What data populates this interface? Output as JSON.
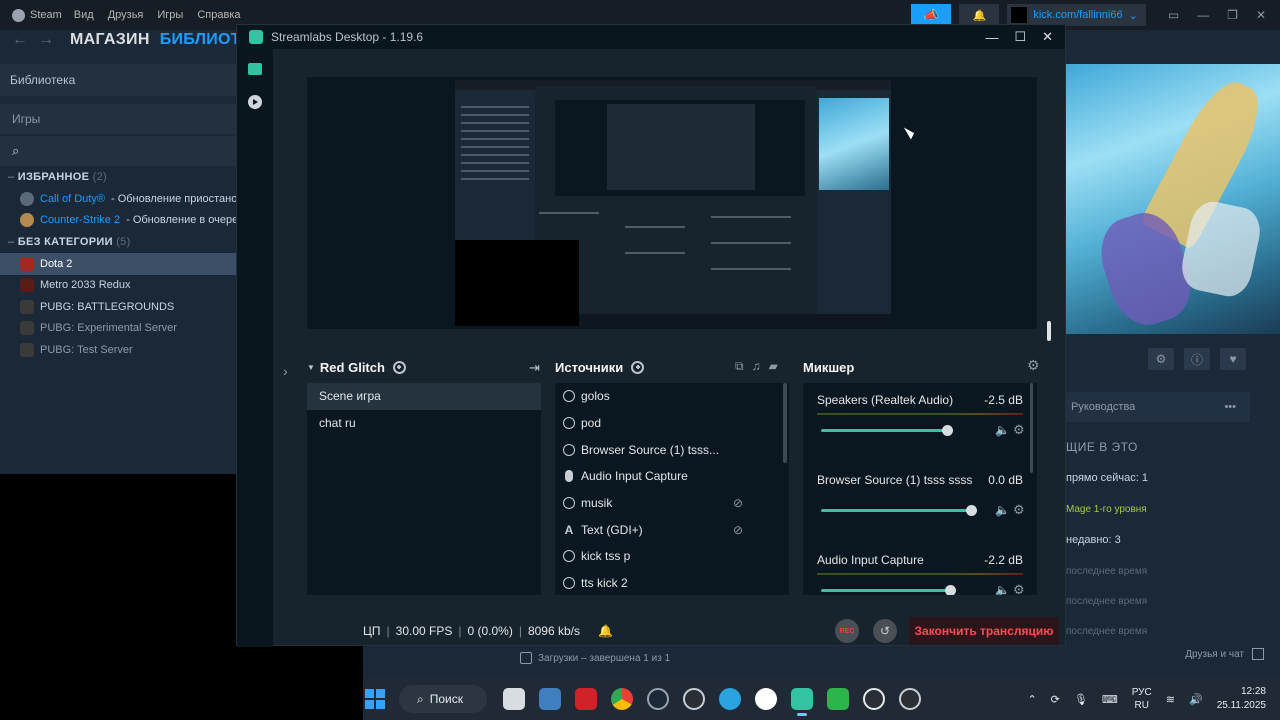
{
  "steam": {
    "app_name": "Steam",
    "menu": [
      "Вид",
      "Друзья",
      "Игры",
      "Справка"
    ],
    "account": "kick.com/fallinni66",
    "nav_store": "МАГАЗИН",
    "nav_library": "БИБЛИОТЕ",
    "library_label": "Библиотека",
    "games_filter": "Игры",
    "favorites": {
      "label": "ИЗБРАННОЕ",
      "count": "(2)"
    },
    "favorite_games": [
      {
        "name": "Call of Duty®",
        "status": " - Обновление приостано"
      },
      {
        "name": "Counter-Strike 2",
        "status": " - Обновление в очере"
      }
    ],
    "uncategorized": {
      "label": "БЕЗ КАТЕГОРИИ",
      "count": "(5)"
    },
    "games": [
      "Dota 2",
      "Metro 2033 Redux",
      "PUBG: BATTLEGROUNDS",
      "PUBG: Experimental Server",
      "PUBG: Test Server"
    ],
    "guides": "Руководства",
    "playing_header": "ЩИЕ В ЭТО",
    "now_playing": "прямо сейчас: 1",
    "friend_level": "Mage 1-го уровня",
    "recently": "недавно: 3",
    "last_time": [
      "последнее время",
      "последнее время",
      "последнее время"
    ],
    "downloads": "Загрузки – завершена 1 из 1",
    "friends_chat": "Друзья и чат"
  },
  "streamlabs": {
    "title": "Streamlabs Desktop - 1.19.6",
    "scene_collection": "Red Glitch",
    "scenes": [
      "Scene игра",
      "chat ru"
    ],
    "sources_title": "Источники",
    "sources": [
      {
        "name": "golos",
        "type": "globe",
        "hidden": false
      },
      {
        "name": "pod",
        "type": "globe",
        "hidden": false
      },
      {
        "name": "Browser Source (1) tsss...",
        "type": "globe",
        "hidden": false
      },
      {
        "name": "Audio Input Capture",
        "type": "mic",
        "hidden": false
      },
      {
        "name": "musik",
        "type": "globe",
        "hidden": true
      },
      {
        "name": "Text (GDI+)",
        "type": "text",
        "hidden": true
      },
      {
        "name": "kick tss p",
        "type": "globe",
        "hidden": false
      },
      {
        "name": "tts kick 2",
        "type": "globe",
        "hidden": false
      }
    ],
    "mixer_title": "Микшер",
    "mixer": [
      {
        "name": "Speakers (Realtek Audio)",
        "db": "-2.5 dB",
        "level": 0.84
      },
      {
        "name": "Browser Source (1) tsss ssss",
        "db": "0.0 dB",
        "level": 1.0
      },
      {
        "name": "Audio Input Capture",
        "db": "-2.2 dB",
        "level": 0.86
      }
    ],
    "footer": {
      "cpu": "ЦП",
      "fps": "30.00 FPS",
      "dropped": "0 (0.0%)",
      "bitrate": "8096 kb/s",
      "rec": "REC",
      "end_stream": "Закончить трансляцию"
    }
  },
  "taskbar": {
    "search": "Поиск",
    "lang": [
      "РУС",
      "RU"
    ],
    "time": "12:28",
    "date": "25.11.2025"
  }
}
